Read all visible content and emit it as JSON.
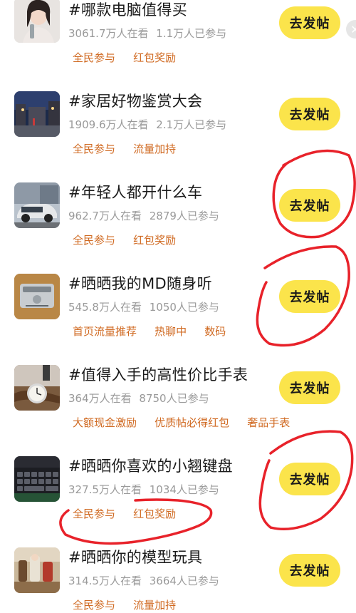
{
  "topics": [
    {
      "title": "#哪款电脑值得买",
      "viewers": "3061.7万人在看",
      "participants": "1.1万人已参与",
      "tags": [
        "全民参与",
        "红包奖励"
      ],
      "button": "去发帖",
      "thumb_icon": "woman-portrait-image"
    },
    {
      "title": "#家居好物鉴赏大会",
      "viewers": "1909.6万人在看",
      "participants": "2.1万人已参与",
      "tags": [
        "全民参与",
        "流量加持"
      ],
      "button": "去发帖",
      "thumb_icon": "street-night-image"
    },
    {
      "title": "#年轻人都开什么车",
      "viewers": "962.7万人在看",
      "participants": "2879人已参与",
      "tags": [
        "全民参与",
        "红包奖励"
      ],
      "button": "去发帖",
      "thumb_icon": "car-image"
    },
    {
      "title": "#晒晒我的MD随身听",
      "viewers": "545.8万人在看",
      "participants": "1050人已参与",
      "tags": [
        "首页流量推荐",
        "热聊中",
        "数码"
      ],
      "button": "去发帖",
      "thumb_icon": "md-player-image"
    },
    {
      "title": "#值得入手的高性价比手表",
      "viewers": "364万人在看",
      "participants": "8750人已参与",
      "tags": [
        "大额现金激励",
        "优质帖必得红包",
        "奢品手表"
      ],
      "button": "去发帖",
      "thumb_icon": "watch-image"
    },
    {
      "title": "#晒晒你喜欢的小翘键盘",
      "viewers": "327.5万人在看",
      "participants": "1034人已参与",
      "tags": [
        "全民参与",
        "红包奖励"
      ],
      "button": "去发帖",
      "thumb_icon": "keyboard-image"
    },
    {
      "title": "#晒晒你的模型玩具",
      "viewers": "314.5万人在看",
      "participants": "3664人已参与",
      "tags": [
        "全民参与",
        "流量加持"
      ],
      "button": "去发帖",
      "thumb_icon": "toy-models-image"
    }
  ],
  "colors": {
    "button_bg": "#fbe44b",
    "tag_text": "#d06a22",
    "stats_text": "#9a9a9a",
    "annotation_red": "#e8222a"
  },
  "close_icon": "close-icon"
}
